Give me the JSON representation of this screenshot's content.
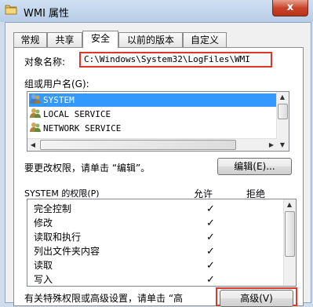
{
  "window": {
    "title": "WMI 属性",
    "close_glyph": "x"
  },
  "tabs": [
    "常规",
    "共享",
    "安全",
    "以前的版本",
    "自定义"
  ],
  "active_tab": "安全",
  "object_name": {
    "label": "对象名称:",
    "value": "C:\\Windows\\System32\\LogFiles\\WMI"
  },
  "groups": {
    "label": "组或用户名(G):",
    "items": [
      "SYSTEM",
      "LOCAL SERVICE",
      "NETWORK SERVICE"
    ],
    "selected": "SYSTEM"
  },
  "edit_hint": "要更改权限，请单击 “编辑”。",
  "edit_button": "编辑(E)...",
  "permissions": {
    "header": "SYSTEM 的权限(P)",
    "allow": "允许",
    "deny": "拒绝",
    "rows": [
      "完全控制",
      "修改",
      "读取和执行",
      "列出文件夹内容",
      "读取",
      "写入"
    ],
    "allow_checked": [
      true,
      true,
      true,
      true,
      true,
      true
    ],
    "check_glyph": "✓"
  },
  "advanced_hint": "有关特殊权限或高级设置，请单击 “高",
  "advanced_button": "高级(V)"
}
